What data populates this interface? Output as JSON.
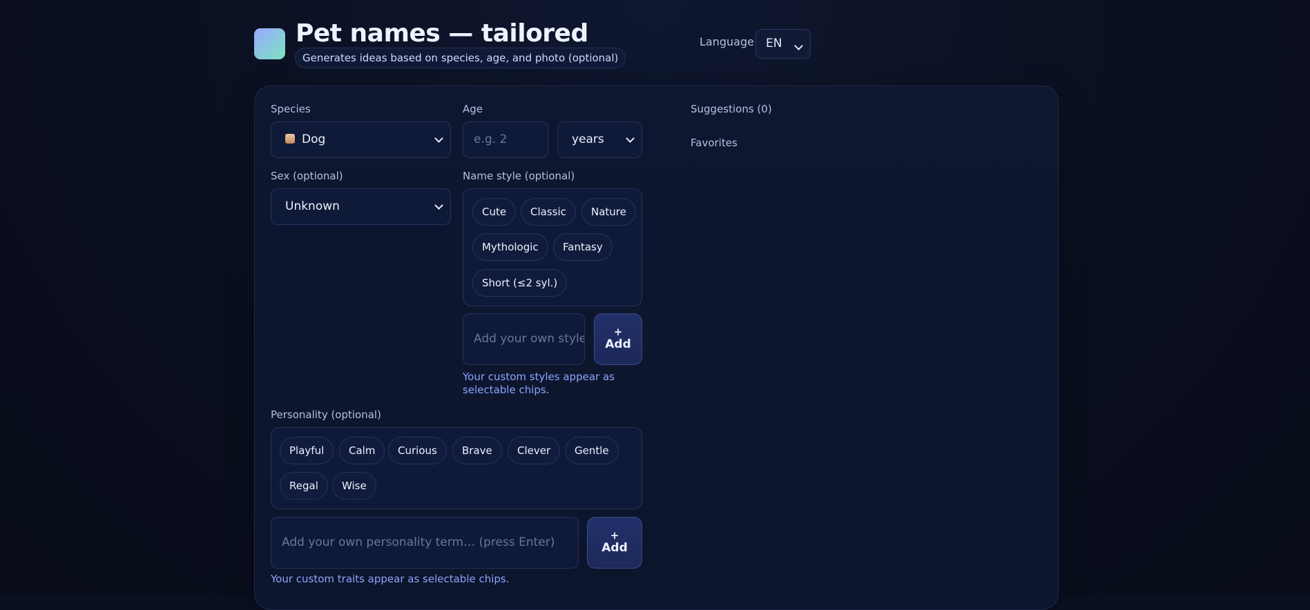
{
  "header": {
    "title": "Pet names — tailored",
    "subtitle": "Generates ideas based on species, age, and photo (optional)",
    "language_label": "Language",
    "language_value": "EN"
  },
  "form": {
    "species_label": "Species",
    "species_value": "Dog",
    "age_label": "Age",
    "age_placeholder": "e.g. 2",
    "age_unit_value": "years",
    "sex_label": "Sex (optional)",
    "sex_value": "Unknown",
    "style_label": "Name style (optional)",
    "style_chips": [
      "Cute",
      "Classic",
      "Nature",
      "Mythologic",
      "Fantasy",
      "Short (≤2 syl.)"
    ],
    "style_input_placeholder": "Add your own style…",
    "style_add_plus": "+",
    "style_add_label": "Add",
    "style_hint": "Your custom styles appear as selectable chips.",
    "personality_label": "Personality (optional)",
    "personality_chips": [
      "Playful",
      "Calm",
      "Curious",
      "Brave",
      "Clever",
      "Gentle",
      "Regal",
      "Wise"
    ],
    "personality_input_placeholder": "Add your own personality term… (press Enter)",
    "personality_add_plus": "+",
    "personality_add_label": "Add",
    "personality_hint": "Your custom traits appear as selectable chips."
  },
  "results": {
    "suggestions_label": "Suggestions (0)",
    "favorites_label": "Favorites"
  },
  "colors": {
    "background": "#0b1020",
    "accent_text": "#8ea4ff",
    "logo_gradient_start": "#9aa8ff",
    "logo_gradient_end": "#7ce3c0"
  }
}
